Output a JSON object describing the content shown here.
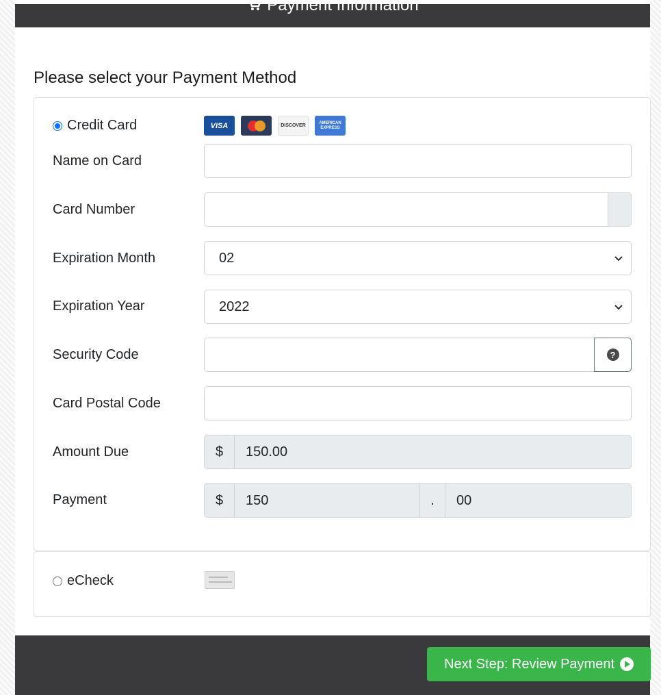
{
  "header": {
    "title": "Payment Information",
    "icon": "cart-icon"
  },
  "section_title": "Please select your Payment Method",
  "credit_card": {
    "option_label": "Credit Card",
    "selected": true,
    "logos": [
      "VISA",
      "MasterCard",
      "DISCOVER",
      "AMERICAN EXPRESS"
    ],
    "fields": {
      "name_on_card": {
        "label": "Name on Card",
        "value": ""
      },
      "card_number": {
        "label": "Card Number",
        "value": ""
      },
      "exp_month": {
        "label": "Expiration Month",
        "value": "02"
      },
      "exp_year": {
        "label": "Expiration Year",
        "value": "2022"
      },
      "security_code": {
        "label": "Security Code",
        "value": "",
        "help_icon": "question-circle-icon"
      },
      "postal_code": {
        "label": "Card Postal Code",
        "value": ""
      },
      "amount_due": {
        "label": "Amount Due",
        "currency": "$",
        "value": "150.00"
      },
      "payment": {
        "label": "Payment",
        "currency": "$",
        "dollars": "150",
        "separator": ".",
        "cents": "00"
      }
    }
  },
  "echeck": {
    "option_label": "eCheck",
    "selected": false,
    "icon": "check-icon"
  },
  "footer": {
    "next_button": "Next Step: Review Payment",
    "next_icon": "play-circle-icon"
  },
  "colors": {
    "dark_bar": "#3a3a3c",
    "accent_green": "#39b54a",
    "radio_blue": "#0d6efd"
  }
}
